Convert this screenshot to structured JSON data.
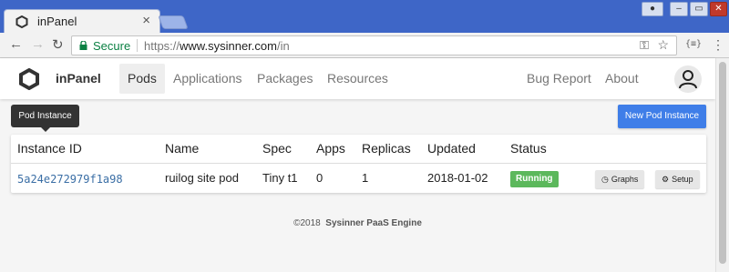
{
  "browser": {
    "tab_title": "inPanel",
    "tab_close": "×",
    "secure_label": "Secure",
    "url_protocol": "https://",
    "url_host": "www.sysinner.com",
    "url_path": "/in",
    "extension_label": "{≡}"
  },
  "app": {
    "brand": "inPanel",
    "nav": [
      {
        "label": "Pods",
        "active": true
      },
      {
        "label": "Applications"
      },
      {
        "label": "Packages"
      },
      {
        "label": "Resources"
      }
    ],
    "nav_right": [
      {
        "label": "Bug Report"
      },
      {
        "label": "About"
      }
    ],
    "tooltip": "Pod Instance",
    "new_button": "New Pod Instance"
  },
  "table": {
    "columns": [
      "Instance ID",
      "Name",
      "Spec",
      "Apps",
      "Replicas",
      "Updated",
      "Status"
    ],
    "rows": [
      {
        "instance_id": "5a24e272979f1a98",
        "name": "ruilog site pod",
        "spec": "Tiny t1",
        "apps": "0",
        "replicas": "1",
        "updated": "2018-01-02",
        "status": "Running",
        "actions": [
          "Graphs",
          "Setup"
        ]
      }
    ]
  },
  "footer": {
    "copyright": "©2018",
    "company": "Sysinner PaaS Engine"
  },
  "colors": {
    "tabstrip": "#3e66c7",
    "primary_button": "#3f7ee8",
    "status_running": "#5cb85c",
    "link": "#3a6ea5",
    "secure": "#0b8043"
  }
}
